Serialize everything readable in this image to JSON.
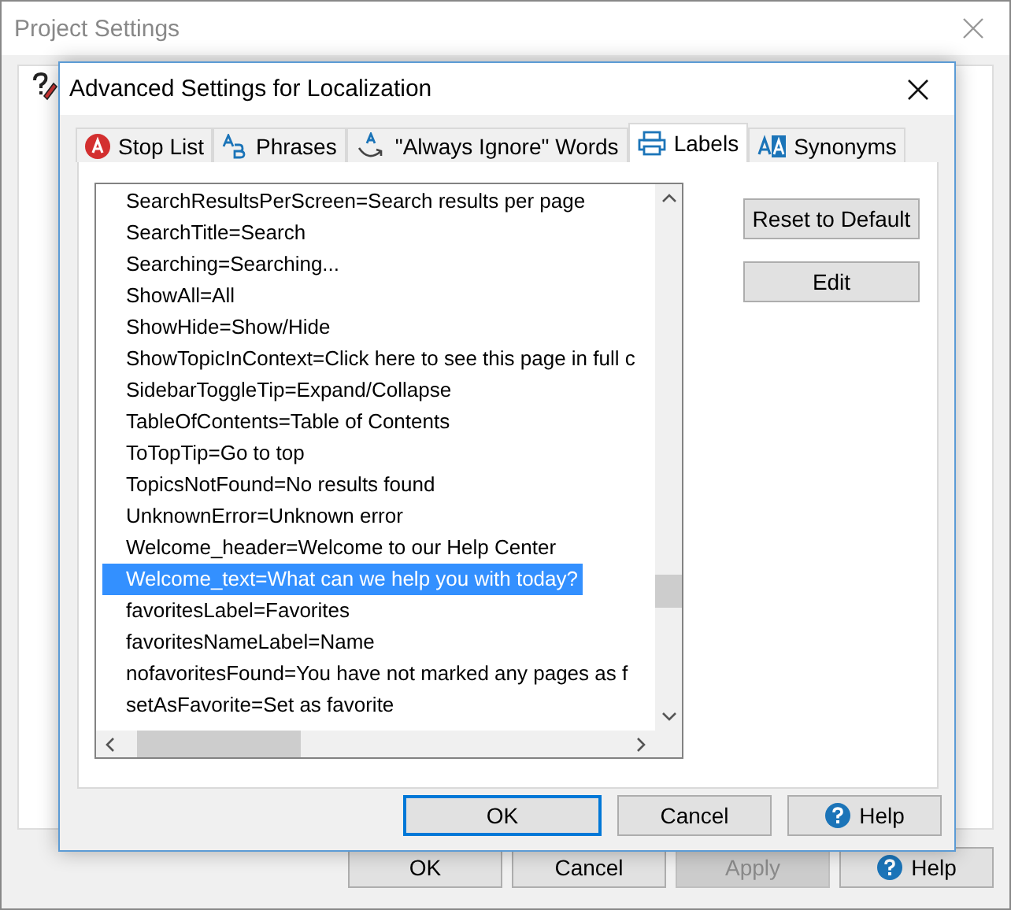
{
  "window": {
    "title": "Project Settings"
  },
  "buttons": [
    {
      "label": "OK",
      "disabled": false,
      "icon": false
    },
    {
      "label": "Cancel",
      "disabled": false,
      "icon": false
    },
    {
      "label": "Apply",
      "disabled": true,
      "icon": false
    },
    {
      "label": "Help",
      "disabled": false,
      "icon": true
    }
  ],
  "dialog": {
    "title": "Advanced Settings for Localization",
    "tabs": [
      {
        "label": "Stop List",
        "kind": "stop",
        "selected": false
      },
      {
        "label": "Phrases",
        "kind": "ab",
        "selected": false
      },
      {
        "label": "\"Always Ignore\" Words",
        "kind": "ignore",
        "selected": false
      },
      {
        "label": "Labels",
        "kind": "printer",
        "selected": true
      },
      {
        "label": "Synonyms",
        "kind": "aa",
        "selected": false
      }
    ],
    "list": [
      {
        "text": "SearchResultsPerScreen=Search results per page",
        "selected": false
      },
      {
        "text": "SearchTitle=Search",
        "selected": false
      },
      {
        "text": "Searching=Searching...",
        "selected": false
      },
      {
        "text": "ShowAll=All",
        "selected": false
      },
      {
        "text": "ShowHide=Show/Hide",
        "selected": false
      },
      {
        "text": "ShowTopicInContext=Click here to see this page in full c",
        "selected": false
      },
      {
        "text": "SidebarToggleTip=Expand/Collapse",
        "selected": false
      },
      {
        "text": "TableOfContents=Table of Contents",
        "selected": false
      },
      {
        "text": "ToTopTip=Go to top",
        "selected": false
      },
      {
        "text": "TopicsNotFound=No results found",
        "selected": false
      },
      {
        "text": "UnknownError=Unknown error",
        "selected": false
      },
      {
        "text": "Welcome_header=Welcome to our Help Center",
        "selected": false
      },
      {
        "text": "Welcome_text=What can we help you with today?",
        "selected": true
      },
      {
        "text": "favoritesLabel=Favorites",
        "selected": false
      },
      {
        "text": "favoritesNameLabel=Name",
        "selected": false
      },
      {
        "text": "nofavoritesFound=You have not marked any pages as f",
        "selected": false
      },
      {
        "text": "setAsFavorite=Set as favorite",
        "selected": false
      }
    ],
    "side_buttons": [
      "Reset to Default",
      "Edit"
    ],
    "buttons": [
      {
        "label": "OK",
        "default": true,
        "icon": false
      },
      {
        "label": "Cancel",
        "default": false,
        "icon": false
      },
      {
        "label": "Help",
        "default": false,
        "icon": true
      }
    ]
  }
}
